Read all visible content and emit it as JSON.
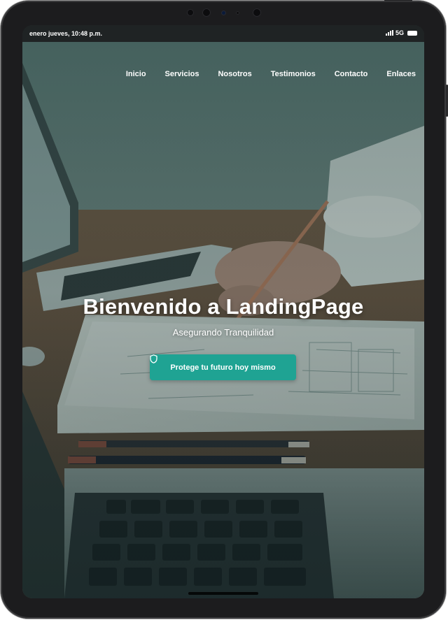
{
  "status_bar": {
    "datetime": "enero jueves, 10:48 p.m.",
    "network": "5G"
  },
  "nav": {
    "items": [
      {
        "label": "Inicio"
      },
      {
        "label": "Servicios"
      },
      {
        "label": "Nosotros"
      },
      {
        "label": "Testimonios"
      },
      {
        "label": "Contacto"
      },
      {
        "label": "Enlaces"
      }
    ]
  },
  "hero": {
    "title": "Bienvenido a LandingPage",
    "subtitle": "Asegurando Tranquilidad",
    "cta_label": "Protege tu futuro hoy mismo",
    "cta_icon": "shield-icon"
  },
  "colors": {
    "accent": "#1fa393",
    "statusbar": "#1f2324",
    "frame": "#1c1c1e"
  }
}
